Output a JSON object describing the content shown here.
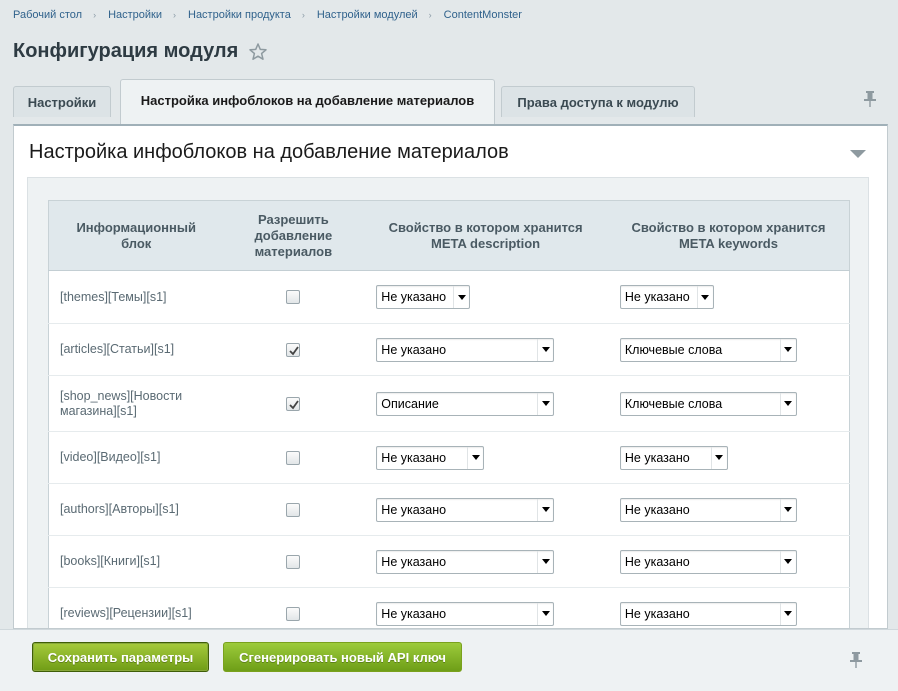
{
  "breadcrumb": [
    "Рабочий стол",
    "Настройки",
    "Настройки продукта",
    "Настройки модулей",
    "ContentMonster"
  ],
  "page_title": "Конфигурация модуля",
  "tabs": [
    {
      "label": "Настройки",
      "active": false
    },
    {
      "label": "Настройка инфоблоков на добавление материалов",
      "active": true
    },
    {
      "label": "Права доступа к модулю",
      "active": false
    }
  ],
  "panel": {
    "title": "Настройка инфоблоков на добавление материалов"
  },
  "table": {
    "headers": {
      "block": "Информационный блок",
      "allow": "Разрешить добавление материалов",
      "description": "Свойство в котором хранится META description",
      "keywords": "Свойство в котором хранится META keywords"
    },
    "rows": [
      {
        "name": "[themes][Темы][s1]",
        "checked": false,
        "description": "Не указано",
        "keywords": "Не указано"
      },
      {
        "name": "[articles][Статьи][s1]",
        "checked": true,
        "description": "Не указано",
        "keywords": "Ключевые слова"
      },
      {
        "name": "[shop_news][Новости магазина][s1]",
        "checked": true,
        "description": "Описание",
        "keywords": "Ключевые слова"
      },
      {
        "name": "[video][Видео][s1]",
        "checked": false,
        "description": "Не указано",
        "keywords": "Не указано"
      },
      {
        "name": "[authors][Авторы][s1]",
        "checked": false,
        "description": "Не указано",
        "keywords": "Не указано"
      },
      {
        "name": "[books][Книги][s1]",
        "checked": false,
        "description": "Не указано",
        "keywords": "Не указано"
      },
      {
        "name": "[reviews][Рецензии][s1]",
        "checked": false,
        "description": "Не указано",
        "keywords": "Не указано"
      }
    ]
  },
  "footer": {
    "save_label": "Сохранить параметры",
    "generate_label": "Сгенерировать новый API ключ"
  },
  "icons": {
    "star": "star-outline-icon",
    "pin": "pin-icon",
    "collapse": "triangle-down-icon",
    "check": "check-icon",
    "dropdown": "chevron-down-icon"
  },
  "colors": {
    "accent_green": "#7aa11d",
    "link_blue": "#30628c",
    "background": "#e3e8ea"
  }
}
